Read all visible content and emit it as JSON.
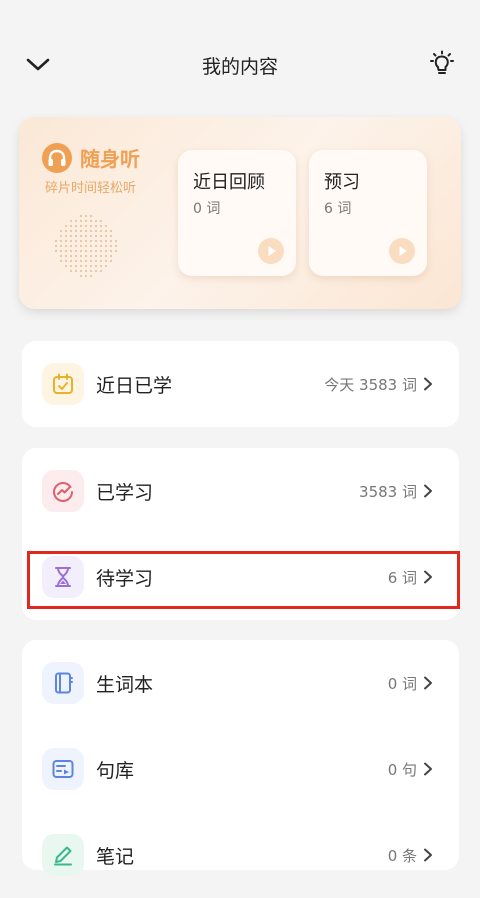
{
  "header": {
    "title": "我的内容"
  },
  "banner": {
    "brand_name": "随身听",
    "slogan": "碎片时间轻松听",
    "cards": [
      {
        "title": "近日回顾",
        "count": "0 词"
      },
      {
        "title": "预习",
        "count": "6 词"
      }
    ]
  },
  "sections": [
    {
      "rows": [
        {
          "label": "近日已学",
          "value": "今天 3583 词",
          "icon": "calendar-check-icon"
        }
      ]
    },
    {
      "rows": [
        {
          "label": "已学习",
          "value": "3583 词",
          "icon": "progress-chart-icon"
        },
        {
          "label": "待学习",
          "value": "6 词",
          "icon": "hourglass-icon"
        }
      ]
    },
    {
      "rows": [
        {
          "label": "生词本",
          "value": "0 词",
          "icon": "notebook-icon"
        },
        {
          "label": "句库",
          "value": "0 句",
          "icon": "sentence-card-icon"
        },
        {
          "label": "笔记",
          "value": "0 条",
          "icon": "pen-icon"
        }
      ]
    }
  ],
  "colors": {
    "accent_orange": "#f0a052",
    "highlight_red": "#e0281e",
    "icon_yellow": "#e9b22a",
    "icon_red": "#e0606a",
    "icon_purple": "#9a6fd8",
    "icon_blue": "#5b86e0",
    "icon_green": "#3cb891"
  }
}
